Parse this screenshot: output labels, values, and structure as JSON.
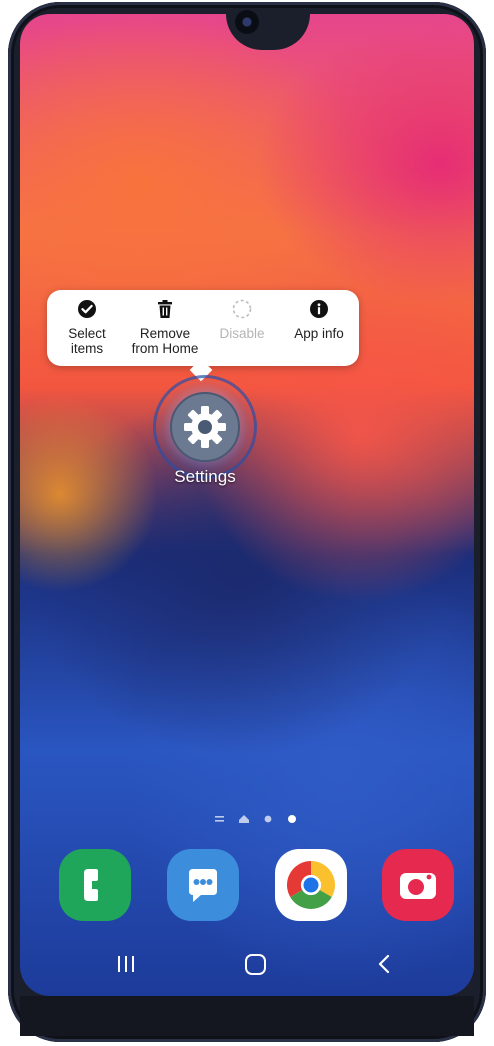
{
  "context_menu": {
    "items": [
      {
        "label_line1": "Select",
        "label_line2": "items",
        "icon": "check-circle-icon",
        "enabled": true
      },
      {
        "label_line1": "Remove",
        "label_line2": "from Home",
        "icon": "trash-icon",
        "enabled": true
      },
      {
        "label_line1": "Disable",
        "label_line2": "",
        "icon": "disable-icon",
        "enabled": false
      },
      {
        "label_line1": "App info",
        "label_line2": "",
        "icon": "info-icon",
        "enabled": true
      }
    ]
  },
  "home": {
    "selected_app": {
      "label": "Settings",
      "icon": "gear-icon"
    },
    "page_indicator": {
      "pages": 3,
      "current": 3
    }
  },
  "dock": {
    "apps": [
      {
        "name": "phone",
        "icon": "phone-icon",
        "color": "#1fa65a"
      },
      {
        "name": "messages",
        "icon": "messages-icon",
        "color": "#3c8ddc"
      },
      {
        "name": "chrome",
        "icon": "chrome-icon",
        "color": "#ffffff"
      },
      {
        "name": "camera",
        "icon": "camera-icon",
        "color": "#e6294f"
      }
    ]
  },
  "navigation": {
    "buttons": [
      "recents-icon",
      "home-icon",
      "back-icon"
    ]
  }
}
